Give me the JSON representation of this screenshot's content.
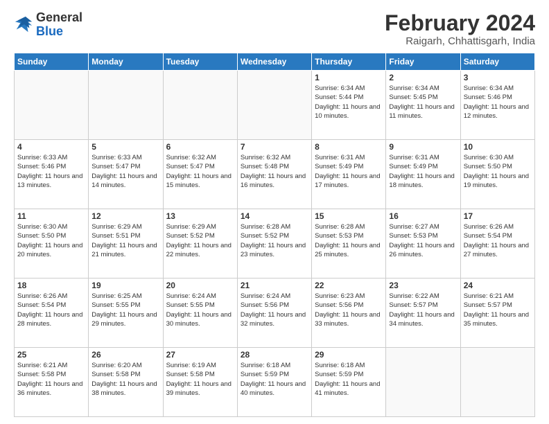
{
  "logo": {
    "general": "General",
    "blue": "Blue"
  },
  "header": {
    "month_year": "February 2024",
    "location": "Raigarh, Chhattisgarh, India"
  },
  "weekdays": [
    "Sunday",
    "Monday",
    "Tuesday",
    "Wednesday",
    "Thursday",
    "Friday",
    "Saturday"
  ],
  "weeks": [
    [
      {
        "day": "",
        "info": ""
      },
      {
        "day": "",
        "info": ""
      },
      {
        "day": "",
        "info": ""
      },
      {
        "day": "",
        "info": ""
      },
      {
        "day": "1",
        "info": "Sunrise: 6:34 AM\nSunset: 5:44 PM\nDaylight: 11 hours and 10 minutes."
      },
      {
        "day": "2",
        "info": "Sunrise: 6:34 AM\nSunset: 5:45 PM\nDaylight: 11 hours and 11 minutes."
      },
      {
        "day": "3",
        "info": "Sunrise: 6:34 AM\nSunset: 5:46 PM\nDaylight: 11 hours and 12 minutes."
      }
    ],
    [
      {
        "day": "4",
        "info": "Sunrise: 6:33 AM\nSunset: 5:46 PM\nDaylight: 11 hours and 13 minutes."
      },
      {
        "day": "5",
        "info": "Sunrise: 6:33 AM\nSunset: 5:47 PM\nDaylight: 11 hours and 14 minutes."
      },
      {
        "day": "6",
        "info": "Sunrise: 6:32 AM\nSunset: 5:47 PM\nDaylight: 11 hours and 15 minutes."
      },
      {
        "day": "7",
        "info": "Sunrise: 6:32 AM\nSunset: 5:48 PM\nDaylight: 11 hours and 16 minutes."
      },
      {
        "day": "8",
        "info": "Sunrise: 6:31 AM\nSunset: 5:49 PM\nDaylight: 11 hours and 17 minutes."
      },
      {
        "day": "9",
        "info": "Sunrise: 6:31 AM\nSunset: 5:49 PM\nDaylight: 11 hours and 18 minutes."
      },
      {
        "day": "10",
        "info": "Sunrise: 6:30 AM\nSunset: 5:50 PM\nDaylight: 11 hours and 19 minutes."
      }
    ],
    [
      {
        "day": "11",
        "info": "Sunrise: 6:30 AM\nSunset: 5:50 PM\nDaylight: 11 hours and 20 minutes."
      },
      {
        "day": "12",
        "info": "Sunrise: 6:29 AM\nSunset: 5:51 PM\nDaylight: 11 hours and 21 minutes."
      },
      {
        "day": "13",
        "info": "Sunrise: 6:29 AM\nSunset: 5:52 PM\nDaylight: 11 hours and 22 minutes."
      },
      {
        "day": "14",
        "info": "Sunrise: 6:28 AM\nSunset: 5:52 PM\nDaylight: 11 hours and 23 minutes."
      },
      {
        "day": "15",
        "info": "Sunrise: 6:28 AM\nSunset: 5:53 PM\nDaylight: 11 hours and 25 minutes."
      },
      {
        "day": "16",
        "info": "Sunrise: 6:27 AM\nSunset: 5:53 PM\nDaylight: 11 hours and 26 minutes."
      },
      {
        "day": "17",
        "info": "Sunrise: 6:26 AM\nSunset: 5:54 PM\nDaylight: 11 hours and 27 minutes."
      }
    ],
    [
      {
        "day": "18",
        "info": "Sunrise: 6:26 AM\nSunset: 5:54 PM\nDaylight: 11 hours and 28 minutes."
      },
      {
        "day": "19",
        "info": "Sunrise: 6:25 AM\nSunset: 5:55 PM\nDaylight: 11 hours and 29 minutes."
      },
      {
        "day": "20",
        "info": "Sunrise: 6:24 AM\nSunset: 5:55 PM\nDaylight: 11 hours and 30 minutes."
      },
      {
        "day": "21",
        "info": "Sunrise: 6:24 AM\nSunset: 5:56 PM\nDaylight: 11 hours and 32 minutes."
      },
      {
        "day": "22",
        "info": "Sunrise: 6:23 AM\nSunset: 5:56 PM\nDaylight: 11 hours and 33 minutes."
      },
      {
        "day": "23",
        "info": "Sunrise: 6:22 AM\nSunset: 5:57 PM\nDaylight: 11 hours and 34 minutes."
      },
      {
        "day": "24",
        "info": "Sunrise: 6:21 AM\nSunset: 5:57 PM\nDaylight: 11 hours and 35 minutes."
      }
    ],
    [
      {
        "day": "25",
        "info": "Sunrise: 6:21 AM\nSunset: 5:58 PM\nDaylight: 11 hours and 36 minutes."
      },
      {
        "day": "26",
        "info": "Sunrise: 6:20 AM\nSunset: 5:58 PM\nDaylight: 11 hours and 38 minutes."
      },
      {
        "day": "27",
        "info": "Sunrise: 6:19 AM\nSunset: 5:58 PM\nDaylight: 11 hours and 39 minutes."
      },
      {
        "day": "28",
        "info": "Sunrise: 6:18 AM\nSunset: 5:59 PM\nDaylight: 11 hours and 40 minutes."
      },
      {
        "day": "29",
        "info": "Sunrise: 6:18 AM\nSunset: 5:59 PM\nDaylight: 11 hours and 41 minutes."
      },
      {
        "day": "",
        "info": ""
      },
      {
        "day": "",
        "info": ""
      }
    ]
  ]
}
